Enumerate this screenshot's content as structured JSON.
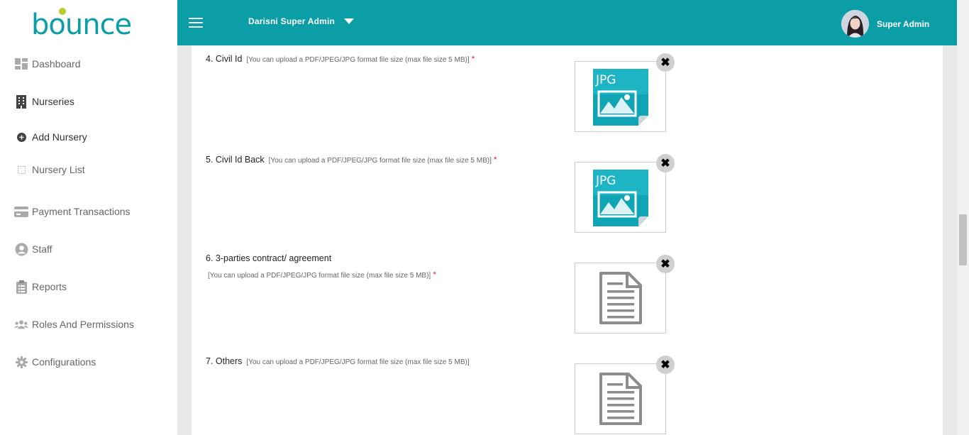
{
  "brand": {
    "logo_text": "bounce",
    "color": "#0c9ea6"
  },
  "topbar": {
    "org_name": "Darisni Super Admin",
    "user_name": "Super Admin",
    "background": "#0c9ea6"
  },
  "sidebar": {
    "items": [
      {
        "label": "Dashboard",
        "icon": "dashboard-icon"
      },
      {
        "label": "Nurseries",
        "icon": "building-icon"
      },
      {
        "label": "Add Nursery",
        "icon": "plus-circle-icon"
      },
      {
        "label": "Nursery List",
        "icon": "square-icon"
      },
      {
        "label": "Payment Transactions",
        "icon": "credit-card-icon"
      },
      {
        "label": "Staff",
        "icon": "user-circle-icon"
      },
      {
        "label": "Reports",
        "icon": "clipboard-icon"
      },
      {
        "label": "Roles And Permissions",
        "icon": "users-icon"
      },
      {
        "label": "Configurations",
        "icon": "gear-icon"
      }
    ]
  },
  "fields": [
    {
      "number_label": "4. Civil Id",
      "hint": "[You can upload a PDF/JPEG/JPG format file size (max file size 5 MB)]",
      "required": "*",
      "file_type": "jpg-file-icon",
      "file_badge": "JPG",
      "remove": "✖"
    },
    {
      "number_label": "5. Civil Id Back",
      "hint": "[You can upload a PDF/JPEG/JPG format file size (max file size 5 MB)]",
      "required": "*",
      "file_type": "jpg-file-icon",
      "file_badge": "JPG",
      "remove": "✖"
    },
    {
      "number_label": "6. 3-parties contract/ agreement",
      "hint": "[You can upload a PDF/JPEG/JPG format file size (max file size 5 MB)]",
      "required": "*",
      "file_type": "document-icon",
      "remove": "✖"
    },
    {
      "number_label": "7. Others",
      "hint": "[You can upload a PDF/JPEG/JPG format file size (max file size 5 MB)]",
      "required": "",
      "file_type": "document-icon",
      "remove": "✖"
    }
  ]
}
